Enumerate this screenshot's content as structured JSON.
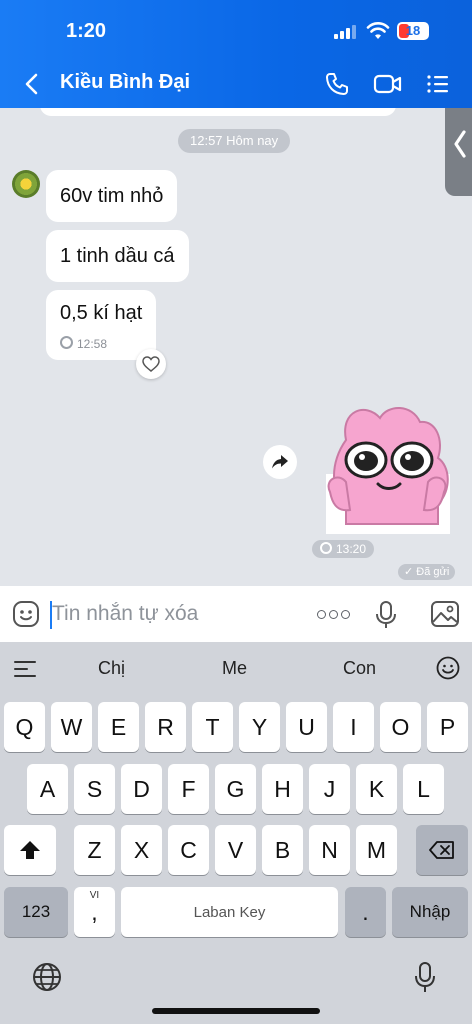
{
  "status_bar": {
    "time": "1:20",
    "battery": "18"
  },
  "header": {
    "title": "Kiều Bình Đại"
  },
  "chat": {
    "time_chip": "12:57 Hôm nay",
    "messages": [
      {
        "text": "60v tim nhỏ"
      },
      {
        "text": "1 tinh dầu cá"
      },
      {
        "text": "0,5 kí hạt",
        "time": "12:58"
      }
    ],
    "sticker_time": "13:20",
    "sent_status": "✓ Đã gửi"
  },
  "composer": {
    "placeholder": "Tin nhắn tự xóa"
  },
  "keyboard": {
    "suggestions": [
      "Chị",
      "Me",
      "Con"
    ],
    "rows": [
      [
        "Q",
        "W",
        "E",
        "R",
        "T",
        "Y",
        "U",
        "I",
        "O",
        "P"
      ],
      [
        "A",
        "S",
        "D",
        "F",
        "G",
        "H",
        "J",
        "K",
        "L"
      ],
      [
        "Z",
        "X",
        "C",
        "V",
        "B",
        "N",
        "M"
      ]
    ],
    "numbers_label": "123",
    "comma_label": ",",
    "comma_hint": "VI",
    "space_label": "Laban Key",
    "period_label": ".",
    "enter_label": "Nhập"
  },
  "colors": {
    "header_blue": "#0a67e6",
    "chat_bg": "#e2e5ea",
    "accent": "#1a7cf5"
  }
}
